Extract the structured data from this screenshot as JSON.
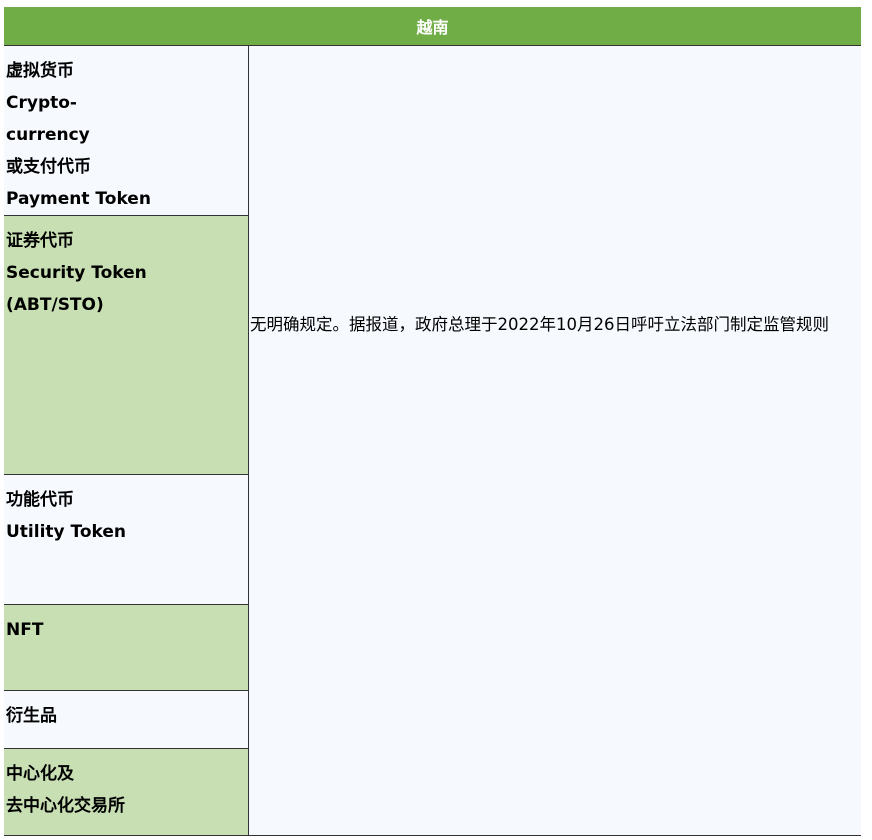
{
  "header": {
    "title": "越南"
  },
  "categories": [
    {
      "lines": [
        "虚拟货币",
        "Crypto-",
        "currency",
        "或支付代币",
        "Payment Token"
      ]
    },
    {
      "lines": [
        "证券代币",
        "Security Token",
        "(ABT/STO)"
      ]
    },
    {
      "lines": [
        "功能代币",
        "Utility Token"
      ]
    },
    {
      "lines": [
        "NFT"
      ]
    },
    {
      "lines": [
        "衍生品"
      ]
    },
    {
      "lines": [
        "中心化及",
        "去中心化交易所"
      ]
    }
  ],
  "description": "无明确规定。据报道，政府总理于2022年10月26日呼吁立法部门制定监管规则",
  "colors": {
    "header_bg": "#70ad47",
    "row_light": "#f6f9fe",
    "row_green": "#c7dfb3"
  }
}
